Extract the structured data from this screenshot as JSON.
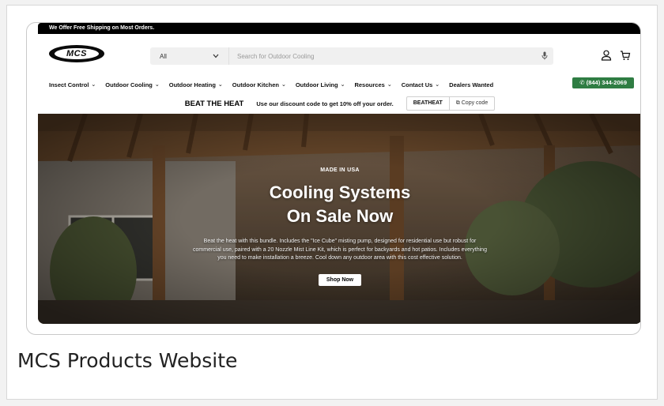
{
  "caption": "MCS Products Website",
  "topbar": {
    "text": "We Offer Free Shipping on Most Orders."
  },
  "logo": {
    "text": "MCS"
  },
  "search": {
    "category": "All",
    "placeholder": "Search for Outdoor Cooling"
  },
  "nav": {
    "items": [
      {
        "label": "Insect Control",
        "has_dropdown": true
      },
      {
        "label": "Outdoor Cooling",
        "has_dropdown": true
      },
      {
        "label": "Outdoor Heating",
        "has_dropdown": true
      },
      {
        "label": "Outdoor Kitchen",
        "has_dropdown": true
      },
      {
        "label": "Outdoor Living",
        "has_dropdown": true
      },
      {
        "label": "Resources",
        "has_dropdown": true
      },
      {
        "label": "Contact Us",
        "has_dropdown": true
      },
      {
        "label": "Dealers Wanted",
        "has_dropdown": false
      }
    ],
    "phone": "(844) 344-2069"
  },
  "promo": {
    "title": "BEAT THE HEAT",
    "text": "Use our discount code to get 10% off your order.",
    "code": "BEATHEAT",
    "copy_label": "Copy code"
  },
  "hero": {
    "kicker": "MADE IN USA",
    "title_line1": "Cooling Systems",
    "title_line2": "On Sale Now",
    "description": "Beat the heat with this bundle. Includes the \"Ice Cube\" misting pump, designed for residential use but robust for commercial use, paired with a 20 Nozzle Mist Line Kit, which is perfect for backyards and hot patios. Includes everything you need to make installation a breeze. Cool down any outdoor area with this cost effective solution.",
    "button": "Shop Now"
  },
  "colors": {
    "topbar": "#000000",
    "phone_button": "#2f7d43",
    "search_bg": "#f0f0f0"
  },
  "icons": {
    "mic": "microphone-icon",
    "account": "user-icon",
    "cart": "cart-icon",
    "phone": "phone-icon",
    "copy": "copy-icon",
    "dropdown": "chevron-down-icon"
  }
}
